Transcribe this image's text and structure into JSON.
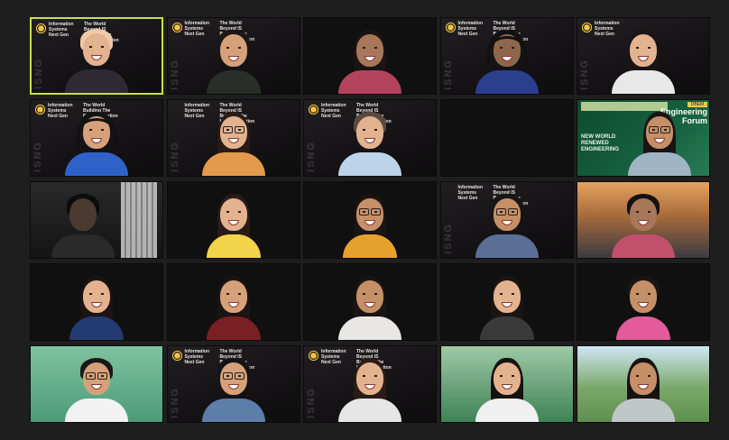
{
  "meeting": {
    "tiles": [
      {
        "id": "p1",
        "bg": "isng",
        "active": true,
        "caption_a": "Information Systems Next Gen",
        "caption_b": "The World Beyond IS Building The Next Generation"
      },
      {
        "id": "p2",
        "bg": "isng",
        "active": false,
        "caption_a": "Information Systems Next Gen",
        "caption_b": "The World Beyond IS Building The Next Generation"
      },
      {
        "id": "p3",
        "bg": "room-white",
        "active": false
      },
      {
        "id": "p4",
        "bg": "isng",
        "active": false,
        "caption_a": "Information Systems Next Gen",
        "caption_b": "The World Beyond IS Building The Next Generation"
      },
      {
        "id": "p5",
        "bg": "isng",
        "active": false,
        "caption_a": "Information Systems Next Gen"
      },
      {
        "id": "p6",
        "bg": "isng",
        "active": false,
        "caption_a": "Information Systems Next Gen",
        "caption_b": "The World Building The Next Generation"
      },
      {
        "id": "p7",
        "bg": "isng",
        "active": false,
        "caption_a": "Information Systems Next Gen",
        "caption_b": "The World Beyond IS Building The Next Generation"
      },
      {
        "id": "p8",
        "bg": "isng",
        "active": false,
        "caption_a": "Information Systems Next Gen",
        "caption_b": "The World Beyond IS Building The Next Generation"
      },
      {
        "id": "empty",
        "bg": "dark",
        "active": false
      },
      {
        "id": "p9",
        "bg": "forum",
        "active": false
      },
      {
        "id": "p10",
        "bg": "dark-room",
        "active": false
      },
      {
        "id": "p11",
        "bg": "room-warm",
        "active": false
      },
      {
        "id": "p12",
        "bg": "room-warm",
        "active": false
      },
      {
        "id": "p13",
        "bg": "isng",
        "active": false,
        "caption_a": "Information Systems Next Gen",
        "caption_b": "The World Beyond IS Building The Next Generation"
      },
      {
        "id": "p14",
        "bg": "sunset",
        "active": false
      },
      {
        "id": "p15",
        "bg": "room-warm",
        "active": false
      },
      {
        "id": "p16",
        "bg": "room-white",
        "active": false
      },
      {
        "id": "p17",
        "bg": "room-warm",
        "active": false
      },
      {
        "id": "p18",
        "bg": "room-white",
        "active": false
      },
      {
        "id": "p19",
        "bg": "room-white",
        "active": false
      },
      {
        "id": "p20",
        "bg": "green",
        "active": false
      },
      {
        "id": "p21",
        "bg": "isng",
        "active": false,
        "caption_a": "Information Systems Next Gen",
        "caption_b": "The World Beyond IS Building The Next Generation"
      },
      {
        "id": "p22",
        "bg": "isng",
        "active": false,
        "caption_a": "Information Systems Next Gen",
        "caption_b": "The World Beyond IS Building The Next Generation"
      },
      {
        "id": "p23",
        "bg": "green",
        "active": false
      },
      {
        "id": "p24",
        "bg": "field",
        "active": false
      }
    ],
    "watermark": "ISNG",
    "forum": {
      "title": "Engineering Forum",
      "subtitle": "NEW WORLD RENEWED ENGINEERING",
      "badge": "DBEM"
    },
    "colors": {
      "active_border": "#c8e04a",
      "background": "#1e1e1e"
    }
  }
}
